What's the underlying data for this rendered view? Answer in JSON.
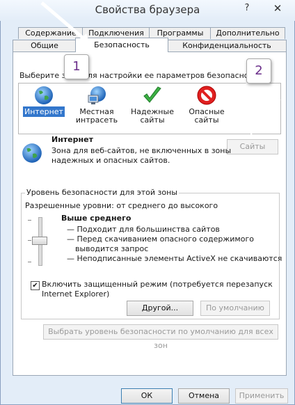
{
  "window": {
    "title": "Свойства браузера",
    "help_label": "?",
    "close_label": "✕"
  },
  "tabs": {
    "row1": [
      "Содержание",
      "Подключения",
      "Программы",
      "Дополнительно"
    ],
    "row2": [
      "Общие",
      "Безопасность",
      "Конфиденциальность"
    ],
    "active": "Безопасность"
  },
  "security": {
    "zone_prompt": "Выберите зону для настройки ее параметров безопасности.",
    "zones": [
      {
        "label_line1": "Интернет",
        "label_line2": "",
        "icon": "globe-icon",
        "selected": true
      },
      {
        "label_line1": "Местная",
        "label_line2": "интрасеть",
        "icon": "intranet-icon",
        "selected": false
      },
      {
        "label_line1": "Надежные",
        "label_line2": "сайты",
        "icon": "checkmark-icon",
        "selected": false
      },
      {
        "label_line1": "Опасные",
        "label_line2": "сайты",
        "icon": "restricted-icon",
        "selected": false
      }
    ],
    "selected_zone_title": "Интернет",
    "selected_zone_desc_line1": "Зона для веб-сайтов, не включенных в зоны",
    "selected_zone_desc_line2": "надежных и опасных сайтов.",
    "sites_button": "Сайты",
    "level_group_title": "Уровень безопасности для этой зоны",
    "allowed_levels": "Разрешенные уровни: от среднего до высокого",
    "level_name": "Выше среднего",
    "level_bullets": [
      "— Подходит для большинства сайтов",
      "— Перед скачиванием опасного содержимого",
      "выводится запрос",
      "— Неподписанные элементы ActiveX не скачиваются"
    ],
    "protected_mode_line1": "Включить защищенный режим (потребуется перезапуск",
    "protected_mode_line2": "Internet Explorer)",
    "protected_mode_checked": true,
    "custom_button": "Другой...",
    "default_button": "По умолчанию",
    "reset_all_button": "Выбрать уровень безопасности по умолчанию для всех зон"
  },
  "footer": {
    "ok": "ОК",
    "cancel": "Отмена",
    "apply": "Применить"
  },
  "callouts": {
    "one": "1",
    "two": "2"
  },
  "colors": {
    "selection": "#3377cc",
    "callout_text": "#6b2f8a",
    "window_bg": "#e3edf8"
  }
}
